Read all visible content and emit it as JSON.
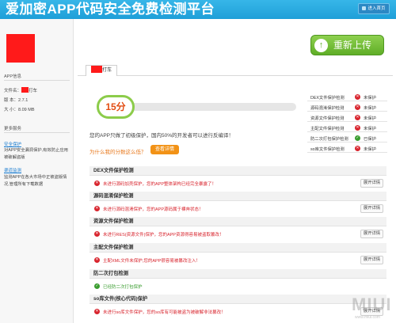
{
  "header": {
    "title": "爱加密APP代码安全免费检测平台",
    "enter_label": "进入首页"
  },
  "sidebar": {
    "app_info_heading": "APP信息",
    "file_name_label": "文件名",
    "file_name_suffix": "打车",
    "version_label": "版 本：2.7.1",
    "size_label": "大 小：8.09 MB",
    "more_services_heading": "更多服务",
    "security_protect_link": "安全保护",
    "security_protect_desc": "对APP安全漏洞保护,有效防止应用被破解盗版",
    "channel_monitor_link": "渠道监测",
    "channel_monitor_desc": "监测APP在各大市场中正被盗版情况,管理所有下载数据"
  },
  "reupload_label": "重新上传",
  "app_tab_label": "打车",
  "score": {
    "value_label": "15分",
    "progress_fraction": 0.15,
    "summary": "您的APP只做了初级保护，国内50%的开发者可以进行反编译！",
    "why_question": "为什么我的分数这么低？",
    "detail_button": "查看详情"
  },
  "protections": [
    {
      "name": "DEX文件保护检测",
      "status": "未保护",
      "ok": false
    },
    {
      "name": "源码混淆保护检测",
      "status": "未保护",
      "ok": false
    },
    {
      "name": "资源文件保护检测",
      "status": "未保护",
      "ok": false
    },
    {
      "name": "主配文件保护检测",
      "status": "未保护",
      "ok": false
    },
    {
      "name": "防二次打包保护检测",
      "status": "已保护",
      "ok": true
    },
    {
      "name": "so库文件保护检测",
      "status": "未保护",
      "ok": false
    }
  ],
  "sections": [
    {
      "title": "DEX文件保护检测",
      "message": "未进行源码加壳保护，您的APP整体架构已经完全暴露了！",
      "ok": false,
      "expand_label": "展开详情"
    },
    {
      "title": "源码混淆保护检测",
      "message": "未进行源码混淆保护，您的APP源码属于裸奔状态！",
      "ok": false,
      "expand_label": "展开详情"
    },
    {
      "title": "资源文件保护检测",
      "message": "未进行RES(资源文件)保护，您的APP资源得容易被盗取篡改！",
      "ok": false,
      "expand_label": "展开详情"
    },
    {
      "title": "主配文件保护检测",
      "message": "主配XML文件未保护,您的APP很容易被篡改注入！",
      "ok": false,
      "expand_label": "展开详情"
    },
    {
      "title": "防二次打包检测",
      "message": "已经防二次打包保护",
      "ok": true,
      "expand_label": ""
    },
    {
      "title": "so库文件(核心代码)保护",
      "message": "未进行so库文件保护，您的so库有可能被盗为被破解非法篡改！",
      "ok": false,
      "expand_label": "展开详情"
    }
  ],
  "watermark": {
    "text": "MIUI",
    "url": "www.miui.com"
  }
}
